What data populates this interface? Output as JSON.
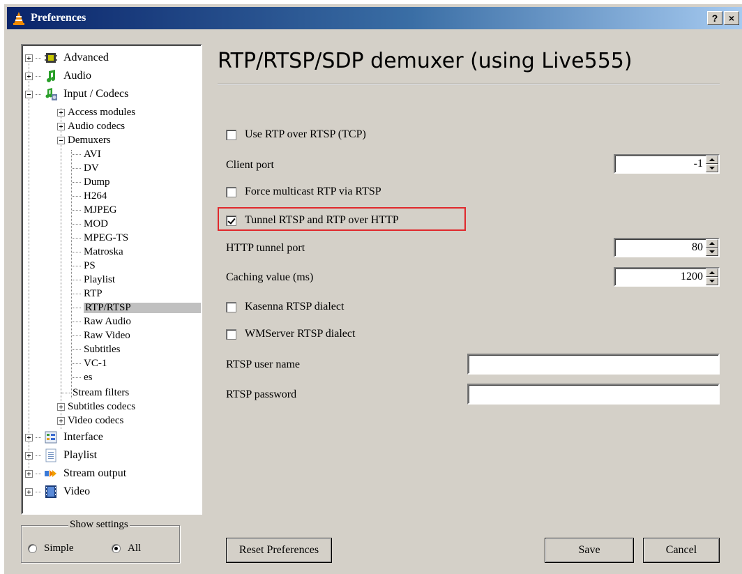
{
  "window": {
    "title": "Preferences",
    "help_button": "?",
    "close_button": "×"
  },
  "tree": {
    "items": [
      {
        "label": "Advanced",
        "icon": "advanced-chip-icon",
        "expander": "+"
      },
      {
        "label": "Audio",
        "icon": "audio-note-icon",
        "expander": "+"
      },
      {
        "label": "Input / Codecs",
        "icon": "input-codecs-icon",
        "expander": "-"
      },
      {
        "label": "Access modules",
        "expander": "+"
      },
      {
        "label": "Audio codecs",
        "expander": "+"
      },
      {
        "label": "Demuxers",
        "expander": "-"
      },
      {
        "label": "AVI"
      },
      {
        "label": "DV"
      },
      {
        "label": "Dump"
      },
      {
        "label": "H264"
      },
      {
        "label": "MJPEG"
      },
      {
        "label": "MOD"
      },
      {
        "label": "MPEG-TS"
      },
      {
        "label": "Matroska"
      },
      {
        "label": "PS"
      },
      {
        "label": "Playlist"
      },
      {
        "label": "RTP"
      },
      {
        "label": "RTP/RTSP",
        "selected": true
      },
      {
        "label": "Raw Audio"
      },
      {
        "label": "Raw Video"
      },
      {
        "label": "Subtitles"
      },
      {
        "label": "VC-1"
      },
      {
        "label": "es"
      },
      {
        "label": "Stream filters"
      },
      {
        "label": "Subtitles codecs",
        "expander": "+"
      },
      {
        "label": "Video codecs",
        "expander": "+"
      },
      {
        "label": "Interface",
        "icon": "interface-icon",
        "expander": "+"
      },
      {
        "label": "Playlist",
        "icon": "playlist-icon",
        "expander": "+"
      },
      {
        "label": "Stream output",
        "icon": "stream-output-icon",
        "expander": "+"
      },
      {
        "label": "Video",
        "icon": "video-film-icon",
        "expander": "+"
      }
    ]
  },
  "show_settings": {
    "legend": "Show settings",
    "simple_label": "Simple",
    "all_label": "All",
    "selected": "All"
  },
  "panel": {
    "heading": "RTP/RTSP/SDP demuxer (using Live555)",
    "use_rtp_over_rtsp": {
      "label": "Use RTP over RTSP (TCP)",
      "checked": false
    },
    "client_port": {
      "label": "Client port",
      "value": "-1"
    },
    "force_multicast": {
      "label": "Force multicast RTP via RTSP",
      "checked": false
    },
    "tunnel_http": {
      "label": "Tunnel RTSP and RTP over HTTP",
      "checked": true
    },
    "http_tunnel_port": {
      "label": "HTTP tunnel port",
      "value": "80"
    },
    "caching_value": {
      "label": "Caching value (ms)",
      "value": "1200"
    },
    "kasenna": {
      "label": "Kasenna RTSP dialect",
      "checked": false
    },
    "wmserver": {
      "label": "WMServer RTSP dialect",
      "checked": false
    },
    "rtsp_user": {
      "label": "RTSP user name",
      "value": ""
    },
    "rtsp_password": {
      "label": "RTSP password",
      "value": ""
    }
  },
  "buttons": {
    "reset": "Reset Preferences",
    "save": "Save",
    "cancel": "Cancel"
  },
  "colors": {
    "highlight_box": "#e0282c",
    "titlebar": "#0a246a",
    "dialog_bg": "#d4d0c8"
  }
}
